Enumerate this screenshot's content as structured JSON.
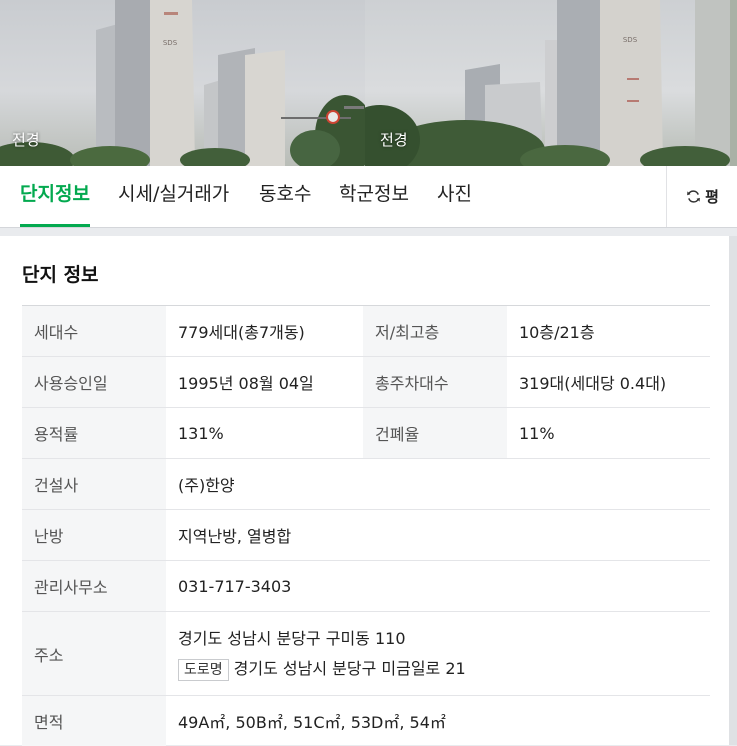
{
  "photos": [
    {
      "caption": "전경",
      "sign": "SDS"
    },
    {
      "caption": "전경",
      "sign": "SDS"
    }
  ],
  "tabs": {
    "items": [
      {
        "label": "단지정보",
        "active": true
      },
      {
        "label": "시세/실거래가",
        "active": false
      },
      {
        "label": "동호수",
        "active": false
      },
      {
        "label": "학군정보",
        "active": false
      },
      {
        "label": "사진",
        "active": false
      }
    ],
    "unit_toggle": {
      "label": "평",
      "icon": "refresh-icon"
    }
  },
  "section": {
    "title": "단지 정보"
  },
  "info": {
    "households_label": "세대수",
    "households_value": "779세대(총7개동)",
    "floors_label": "저/최고층",
    "floors_value": "10층/21층",
    "approval_label": "사용승인일",
    "approval_value": "1995년 08월 04일",
    "parking_label": "총주차대수",
    "parking_value": "319대(세대당 0.4대)",
    "far_label": "용적률",
    "far_value": "131%",
    "bcr_label": "건폐율",
    "bcr_value": "11%",
    "builder_label": "건설사",
    "builder_value": "(주)한양",
    "heating_label": "난방",
    "heating_value": "지역난방, 열병합",
    "office_label": "관리사무소",
    "office_value": "031-717-3403",
    "address_label": "주소",
    "address_value": "경기도 성남시 분당구 구미동 110",
    "road_badge": "도로명",
    "road_value": "경기도 성남시 분당구 미금일로 21",
    "area_label": "면적",
    "area_value": "49A㎡, 50B㎡, 51C㎡, 53D㎡, 54㎡"
  },
  "colors": {
    "accent": "#03a94f",
    "label_bg": "#f5f6f7"
  }
}
